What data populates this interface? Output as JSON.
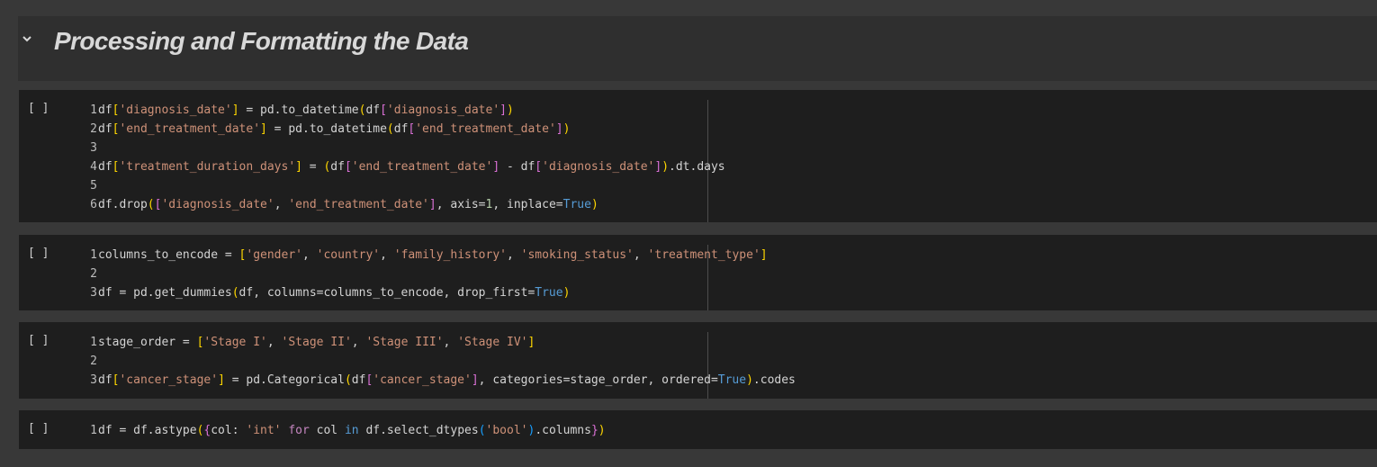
{
  "section": {
    "title": "Processing and Formatting the Data",
    "collapse_icon": "chevron-down-icon"
  },
  "cells": [
    {
      "run_label": "[ ]",
      "lines": [
        [
          [
            "df",
            "p"
          ],
          [
            "[",
            "b1"
          ],
          [
            "'diagnosis_date'",
            "s"
          ],
          [
            "]",
            "b1"
          ],
          [
            " = pd.to_datetime",
            "p"
          ],
          [
            "(",
            "b1"
          ],
          [
            "df",
            "p"
          ],
          [
            "[",
            "b2"
          ],
          [
            "'diagnosis_date'",
            "s"
          ],
          [
            "]",
            "b2"
          ],
          [
            ")",
            "b1"
          ]
        ],
        [
          [
            "df",
            "p"
          ],
          [
            "[",
            "b1"
          ],
          [
            "'end_treatment_date'",
            "s"
          ],
          [
            "]",
            "b1"
          ],
          [
            " = pd.to_datetime",
            "p"
          ],
          [
            "(",
            "b1"
          ],
          [
            "df",
            "p"
          ],
          [
            "[",
            "b2"
          ],
          [
            "'end_treatment_date'",
            "s"
          ],
          [
            "]",
            "b2"
          ],
          [
            ")",
            "b1"
          ]
        ],
        [],
        [
          [
            "df",
            "p"
          ],
          [
            "[",
            "b1"
          ],
          [
            "'treatment_duration_days'",
            "s"
          ],
          [
            "]",
            "b1"
          ],
          [
            " = ",
            "p"
          ],
          [
            "(",
            "b1"
          ],
          [
            "df",
            "p"
          ],
          [
            "[",
            "b2"
          ],
          [
            "'end_treatment_date'",
            "s"
          ],
          [
            "]",
            "b2"
          ],
          [
            " - df",
            "p"
          ],
          [
            "[",
            "b2"
          ],
          [
            "'diagnosis_date'",
            "s"
          ],
          [
            "]",
            "b2"
          ],
          [
            ")",
            "b1"
          ],
          [
            ".dt.days",
            "p"
          ]
        ],
        [],
        [
          [
            "df.drop",
            "p"
          ],
          [
            "(",
            "b1"
          ],
          [
            "[",
            "b2"
          ],
          [
            "'diagnosis_date'",
            "s"
          ],
          [
            ", ",
            "p"
          ],
          [
            "'end_treatment_date'",
            "s"
          ],
          [
            "]",
            "b2"
          ],
          [
            ", axis=",
            "p"
          ],
          [
            "1",
            "num"
          ],
          [
            ", inplace=",
            "p"
          ],
          [
            "True",
            "kw"
          ],
          [
            ")",
            "b1"
          ]
        ]
      ]
    },
    {
      "run_label": "[ ]",
      "lines": [
        [
          [
            "columns_to_encode = ",
            "p"
          ],
          [
            "[",
            "b1"
          ],
          [
            "'gender'",
            "s"
          ],
          [
            ", ",
            "p"
          ],
          [
            "'country'",
            "s"
          ],
          [
            ", ",
            "p"
          ],
          [
            "'family_history'",
            "s"
          ],
          [
            ", ",
            "p"
          ],
          [
            "'smoking_status'",
            "s"
          ],
          [
            ", ",
            "p"
          ],
          [
            "'treatment_type'",
            "s"
          ],
          [
            "]",
            "b1"
          ]
        ],
        [],
        [
          [
            "df = pd.get_dummies",
            "p"
          ],
          [
            "(",
            "b1"
          ],
          [
            "df, columns=columns_to_encode, drop_first=",
            "p"
          ],
          [
            "True",
            "kw"
          ],
          [
            ")",
            "b1"
          ]
        ]
      ]
    },
    {
      "run_label": "[ ]",
      "lines": [
        [
          [
            "stage_order = ",
            "p"
          ],
          [
            "[",
            "b1"
          ],
          [
            "'Stage I'",
            "s"
          ],
          [
            ", ",
            "p"
          ],
          [
            "'Stage II'",
            "s"
          ],
          [
            ", ",
            "p"
          ],
          [
            "'Stage III'",
            "s"
          ],
          [
            ", ",
            "p"
          ],
          [
            "'Stage IV'",
            "s"
          ],
          [
            "]",
            "b1"
          ]
        ],
        [],
        [
          [
            "df",
            "p"
          ],
          [
            "[",
            "b1"
          ],
          [
            "'cancer_stage'",
            "s"
          ],
          [
            "]",
            "b1"
          ],
          [
            " = pd.Categorical",
            "p"
          ],
          [
            "(",
            "b1"
          ],
          [
            "df",
            "p"
          ],
          [
            "[",
            "b2"
          ],
          [
            "'cancer_stage'",
            "s"
          ],
          [
            "]",
            "b2"
          ],
          [
            ", categories=stage_order, ordered=",
            "p"
          ],
          [
            "True",
            "kw"
          ],
          [
            ")",
            "b1"
          ],
          [
            ".codes",
            "p"
          ]
        ]
      ]
    },
    {
      "run_label": "[ ]",
      "lines": [
        [
          [
            "df = df.astype",
            "p"
          ],
          [
            "(",
            "b1"
          ],
          [
            "{",
            "b2"
          ],
          [
            "col: ",
            "p"
          ],
          [
            "'int'",
            "s"
          ],
          [
            " ",
            "p"
          ],
          [
            "for",
            "kw2"
          ],
          [
            " col ",
            "p"
          ],
          [
            "in",
            "kw"
          ],
          [
            " df.select_dtypes",
            "p"
          ],
          [
            "(",
            "b3"
          ],
          [
            "'bool'",
            "s"
          ],
          [
            ")",
            "b3"
          ],
          [
            ".columns",
            "p"
          ],
          [
            "}",
            "b2"
          ],
          [
            ")",
            "b1"
          ]
        ]
      ]
    }
  ]
}
